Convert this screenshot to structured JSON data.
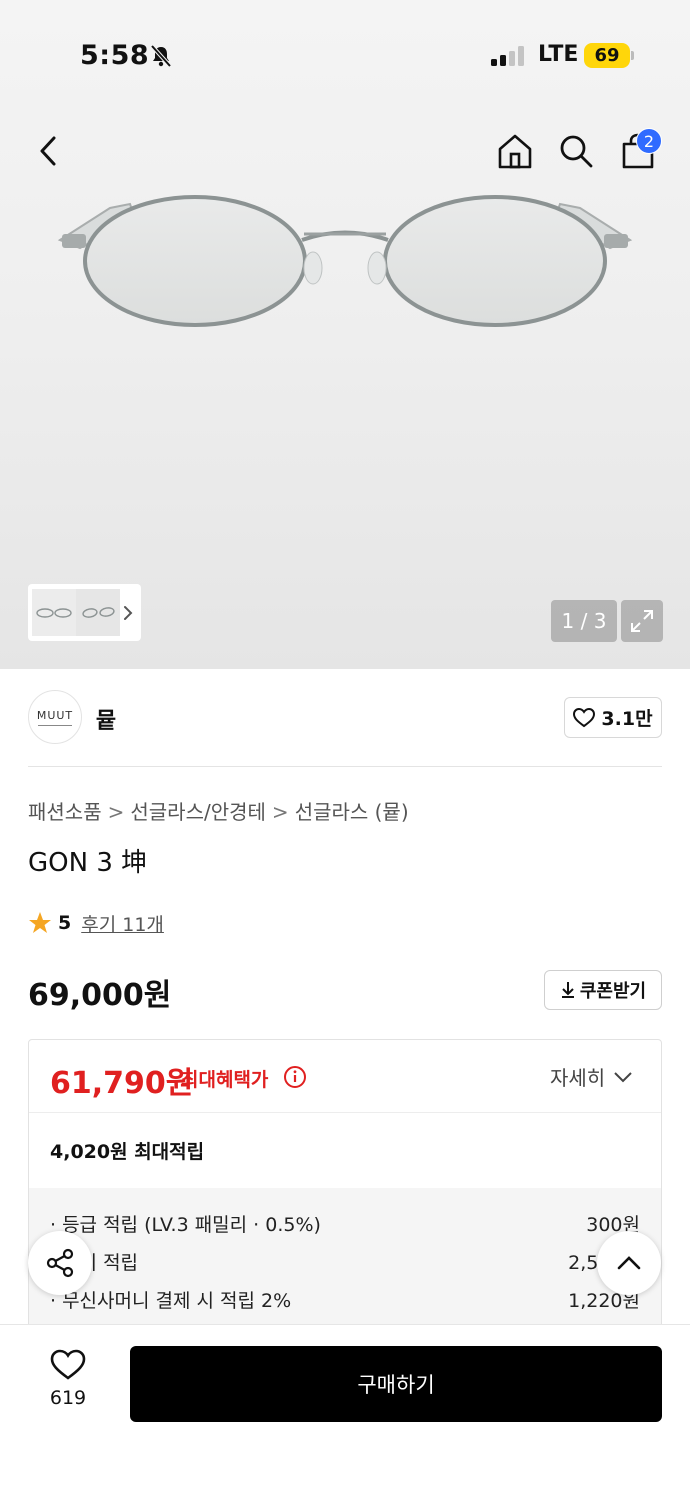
{
  "status_bar": {
    "time": "5:58",
    "network": "LTE",
    "battery": "69"
  },
  "header": {
    "cart_count": "2"
  },
  "gallery": {
    "counter": "1 / 3"
  },
  "brand": {
    "logo_text": "MUUT",
    "name": "뮽",
    "likes": "3.1만"
  },
  "breadcrumb": [
    "패션소품",
    "선글라스/안경테",
    "선글라스 (뮽)"
  ],
  "product": {
    "title": "GON 3 坤",
    "rating": "5",
    "review_link": "후기 11개",
    "price": "69,000원",
    "coupon_label": "쿠폰받기"
  },
  "benefit": {
    "max_price": "61,790원",
    "max_label": "최대혜택가",
    "detail_label": "자세히",
    "points_title": "4,020원 최대적립",
    "points": [
      {
        "label": "· 등급 적립 (LV.3 패밀리 · 0.5%)",
        "value": "300원"
      },
      {
        "label": "· 후기 적립",
        "value": "2,500원"
      },
      {
        "label": "· 무신사머니 결제 시 적립 2%",
        "value": "1,220원"
      }
    ]
  },
  "bottom": {
    "wish_count": "619",
    "buy_label": "구매하기"
  },
  "colors": {
    "accent_red": "#e02020",
    "badge_blue": "#2f6bff",
    "battery_yellow": "#ffd60a"
  }
}
